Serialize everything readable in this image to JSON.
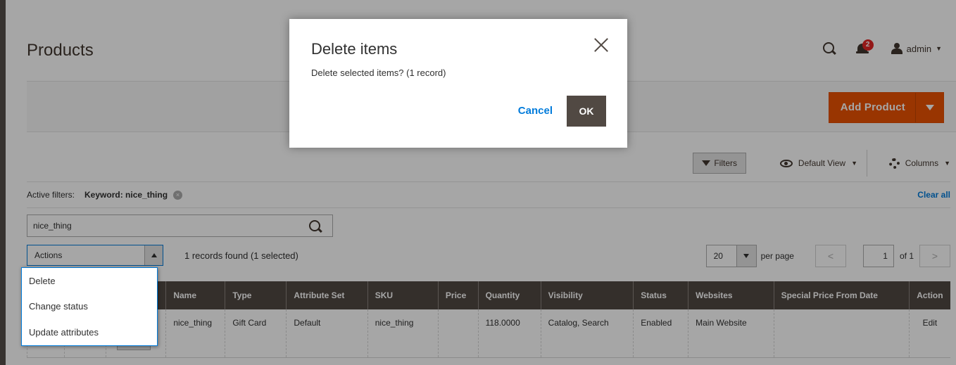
{
  "header": {
    "page_title": "Products",
    "notification_count": "2",
    "user_label": "admin"
  },
  "page_actions": {
    "add_product_label": "Add Product"
  },
  "grid_controls": {
    "filters_label": "Filters",
    "view_label": "Default View",
    "columns_label": "Columns"
  },
  "active_filters": {
    "label": "Active filters:",
    "keyword": "Keyword: nice_thing",
    "remove_glyph": "×",
    "clear_all": "Clear all"
  },
  "search": {
    "value": "nice_thing"
  },
  "mass_actions": {
    "selected_label": "Actions",
    "options": [
      "Delete",
      "Change status",
      "Update attributes"
    ]
  },
  "records_found": "1 records found (1 selected)",
  "pager": {
    "per_page_value": "20",
    "per_page_label": "per page",
    "prev_glyph": "<",
    "next_glyph": ">",
    "current_page": "1",
    "of_label": "of 1"
  },
  "table": {
    "columns": [
      "Name",
      "Type",
      "Attribute Set",
      "SKU",
      "Price",
      "Quantity",
      "Visibility",
      "Status",
      "Websites",
      "Special Price From Date",
      "Action"
    ],
    "rows": [
      {
        "name": "nice_thing",
        "type": "Gift Card",
        "attribute_set": "Default",
        "sku": "nice_thing",
        "price": "",
        "quantity": "118.0000",
        "visibility": "Catalog, Search",
        "status": "Enabled",
        "websites": "Main Website",
        "special_price_from": "",
        "action": "Edit"
      }
    ]
  },
  "modal": {
    "title": "Delete items",
    "message": "Delete selected items? (1 record)",
    "cancel_label": "Cancel",
    "ok_label": "OK"
  },
  "colors": {
    "accent_orange": "#eb5202",
    "link_blue": "#007bdb",
    "header_dark": "#514943"
  }
}
